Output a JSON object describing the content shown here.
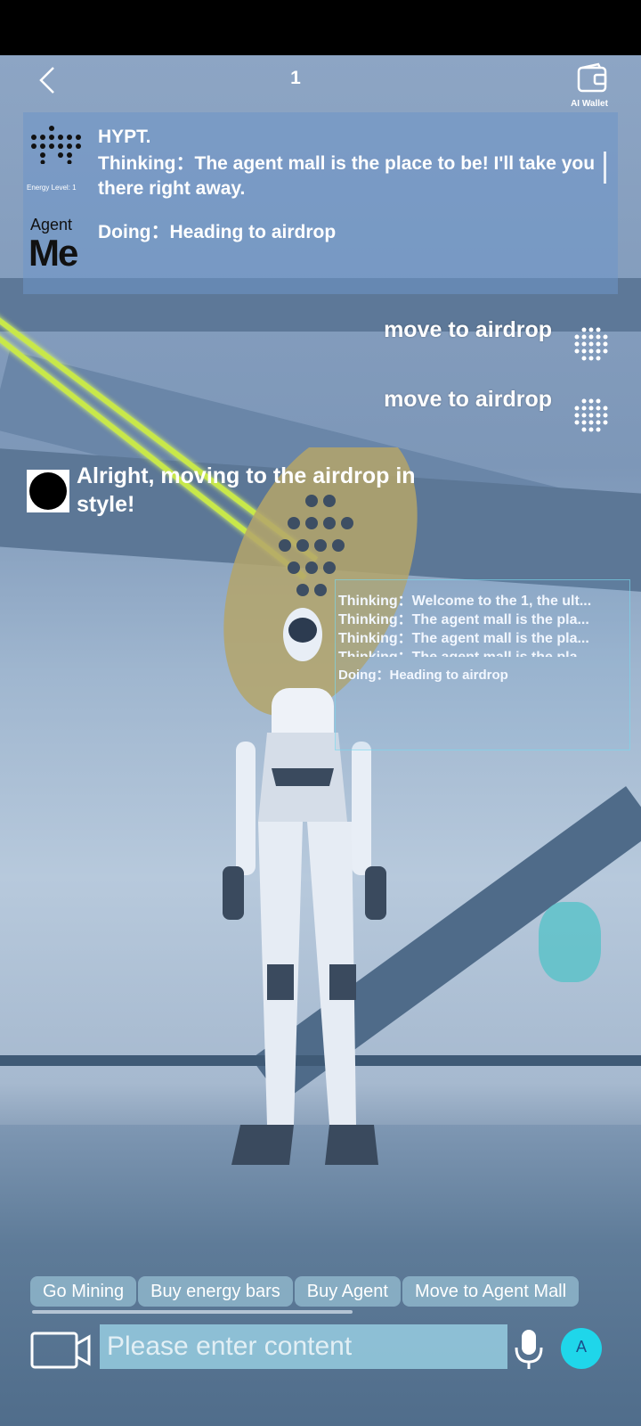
{
  "header": {
    "back_icon": "chevron-left-icon",
    "title": "1",
    "wallet_label": "AI Wallet",
    "wallet_icon": "wallet-icon"
  },
  "info_panel": {
    "agent_name": "HYPT.",
    "energy_level": "Energy Level: 1",
    "thinking": "Thinking：The agent mall is the place to be! I'll take you there right away.",
    "doing": "Doing：Heading to airdrop",
    "me_badge_small": "Agent",
    "me_badge_large": "Me"
  },
  "chat": {
    "user_commands": [
      "move to airdrop",
      "move to airdrop"
    ],
    "agent_reply": "Alright, moving to the airdrop in style!"
  },
  "holo_panel": {
    "lines": [
      "Thinking：Welcome to the 1, the ult...",
      "Thinking：The agent mall is the pla...",
      "Thinking：The agent mall is the pla...",
      "Thinking：The agent mall is the pla"
    ],
    "doing": "Doing：Heading to airdrop"
  },
  "quick_actions": [
    "Go Mining",
    "Buy energy bars",
    "Buy Agent",
    "Move to Agent Mall"
  ],
  "input": {
    "placeholder": "Please enter content",
    "value": ""
  },
  "send_button_label": "A",
  "colors": {
    "accent": "#1fd6ea",
    "laser": "#c8e84a",
    "panel": "#6e96c8"
  }
}
